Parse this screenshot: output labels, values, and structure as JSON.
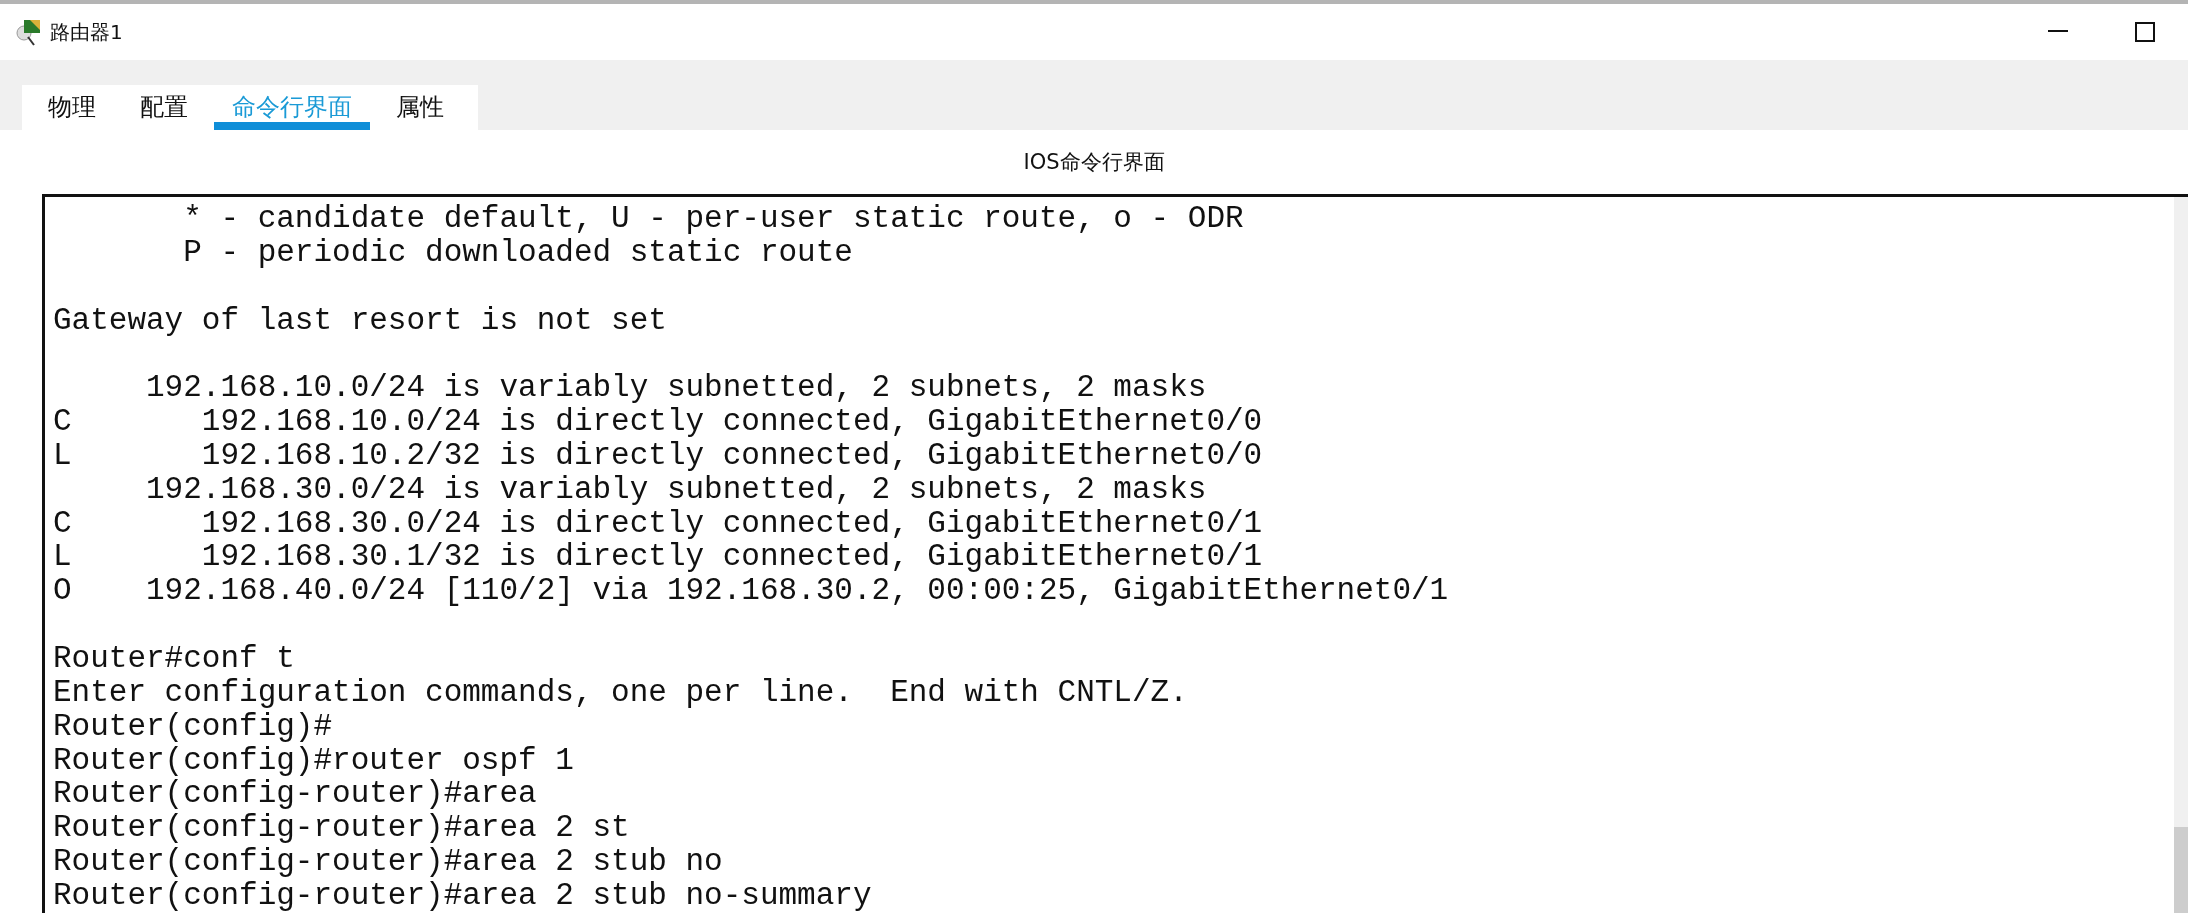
{
  "window": {
    "title": "路由器1"
  },
  "tabs": [
    {
      "label": "物理",
      "selected": false
    },
    {
      "label": "配置",
      "selected": false
    },
    {
      "label": "命令行界面",
      "selected": true
    },
    {
      "label": "属性",
      "selected": false
    }
  ],
  "panel_title": "IOS命令行界面",
  "terminal": {
    "blocks": [
      [
        "       * - candidate default, U - per-user static route, o - ODR",
        "       P - periodic downloaded static route"
      ],
      [
        "Gateway of last resort is not set"
      ],
      [
        "     192.168.10.0/24 is variably subnetted, 2 subnets, 2 masks",
        "C       192.168.10.0/24 is directly connected, GigabitEthernet0/0",
        "L       192.168.10.2/32 is directly connected, GigabitEthernet0/0",
        "     192.168.30.0/24 is variably subnetted, 2 subnets, 2 masks",
        "C       192.168.30.0/24 is directly connected, GigabitEthernet0/1",
        "L       192.168.30.1/32 is directly connected, GigabitEthernet0/1",
        "O    192.168.40.0/24 [110/2] via 192.168.30.2, 00:00:25, GigabitEthernet0/1"
      ],
      [
        "Router#conf t",
        "Enter configuration commands, one per line.  End with CNTL/Z.",
        "Router(config)#",
        "Router(config)#router ospf 1",
        "Router(config-router)#area",
        "Router(config-router)#area 2 st",
        "Router(config-router)#area 2 stub no",
        "Router(config-router)#area 2 stub no-summary"
      ]
    ]
  }
}
